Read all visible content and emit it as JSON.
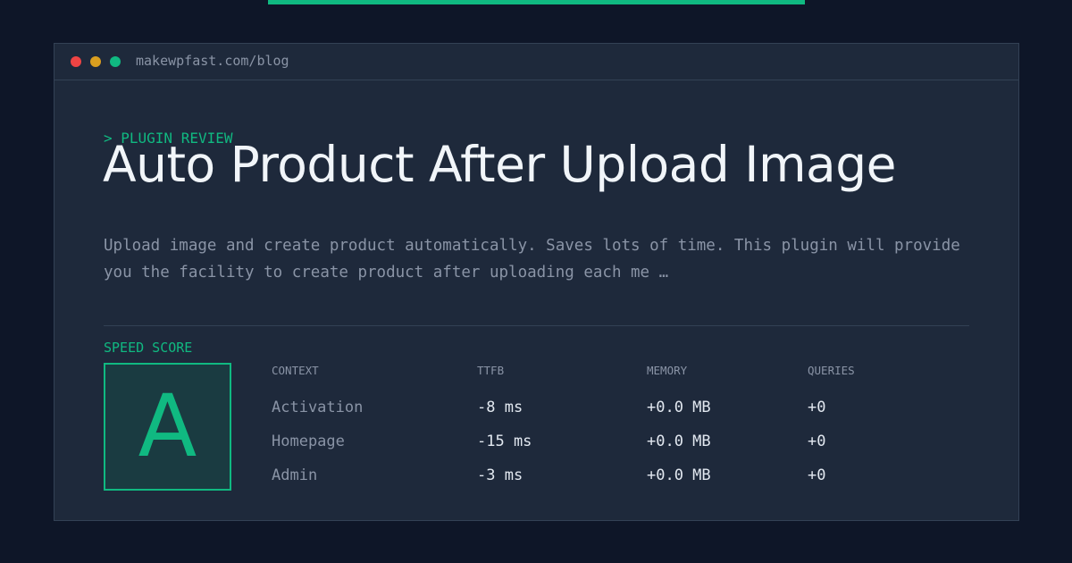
{
  "window": {
    "url": "makewpfast.com/blog"
  },
  "post": {
    "eyebrow": "> PLUGIN REVIEW",
    "title": "Auto Product After Upload Image",
    "description": "Upload image and create product automatically. Saves lots of time. This plugin will provide you the facility to create product after uploading each me …"
  },
  "speed": {
    "label": "SPEED SCORE",
    "grade": "A",
    "columns": [
      "CONTEXT",
      "TTFB",
      "MEMORY",
      "QUERIES"
    ],
    "rows": [
      {
        "context": "Activation",
        "ttfb": "-8 ms",
        "memory": "+0.0 MB",
        "queries": "+0"
      },
      {
        "context": "Homepage",
        "ttfb": "-15 ms",
        "memory": "+0.0 MB",
        "queries": "+0"
      },
      {
        "context": "Admin",
        "ttfb": "-3 ms",
        "memory": "+0.0 MB",
        "queries": "+0"
      }
    ]
  },
  "colors": {
    "background": "#0e1628",
    "panel": "#1e293b",
    "accent": "#10b981",
    "muted": "#8a94a6"
  }
}
